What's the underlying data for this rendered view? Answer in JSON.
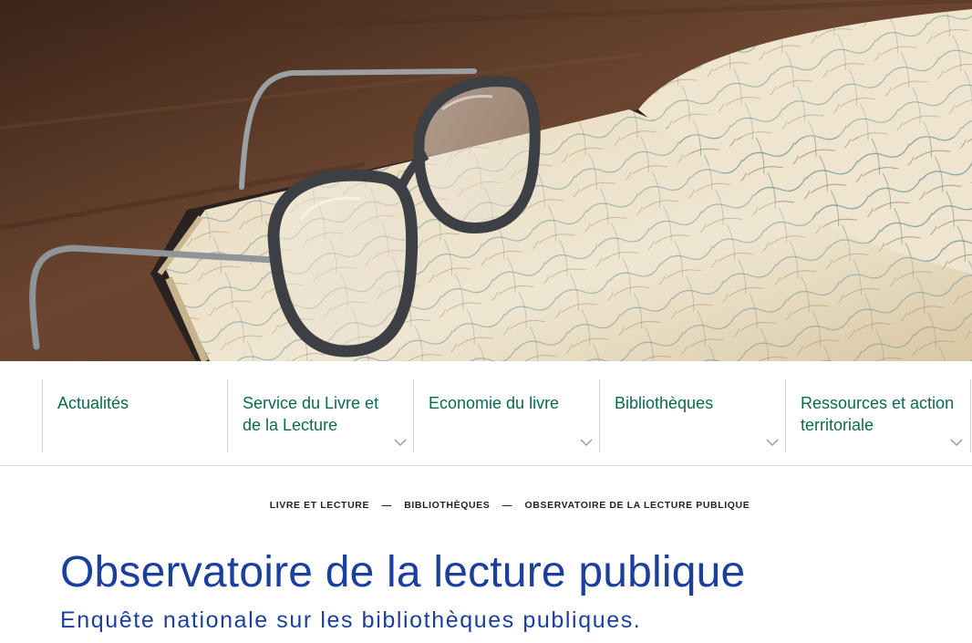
{
  "hero": {
    "image": "glasses-on-atlas-photo"
  },
  "nav": {
    "items": [
      {
        "label": "Actualités",
        "has_dropdown": false
      },
      {
        "label": "Service du Livre et de la Lecture",
        "has_dropdown": true
      },
      {
        "label": "Economie du livre",
        "has_dropdown": true
      },
      {
        "label": "Bibliothèques",
        "has_dropdown": true
      },
      {
        "label": "Ressources et action territoriale",
        "has_dropdown": true
      }
    ],
    "dropdown_icon": "chevron-down-icon"
  },
  "breadcrumb": {
    "items": [
      "LIVRE ET LECTURE",
      "BIBLIOTHÈQUES",
      "OBSERVATOIRE DE LA LECTURE PUBLIQUE"
    ],
    "separator": "—"
  },
  "page": {
    "title": "Observatoire de la lecture publique",
    "subtitle": "Enquête nationale sur les bibliothèques publiques."
  },
  "colors": {
    "nav_text": "#0a6b4c",
    "title": "#1b3f9c",
    "divider": "#d3d3d3"
  }
}
